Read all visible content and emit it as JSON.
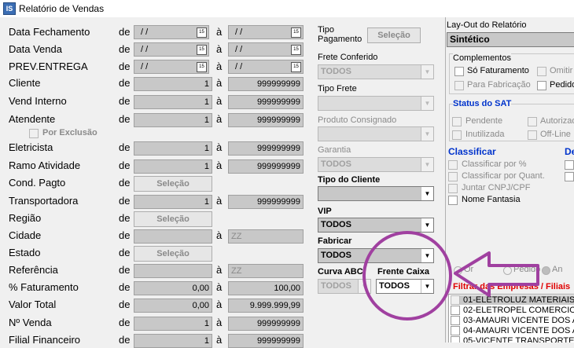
{
  "window": {
    "title": "Relatório de Vendas",
    "icon_text": "IS"
  },
  "common": {
    "de": "de",
    "a": "à",
    "selecao": "Seleção",
    "date_placeholder": "/ /",
    "calendar": "15"
  },
  "fields": {
    "data_fechamento": "Data Fechamento",
    "data_venda": "Data Venda",
    "prev_entrega": "PREV.ENTREGA",
    "cliente": "Cliente",
    "vend_interno": "Vend Interno",
    "atendente": "Atendente",
    "por_exclusao": "Por Exclusão",
    "eletricista": "Eletricista",
    "ramo_atividade": "Ramo Atividade",
    "cond_pagto": "Cond. Pagto",
    "transportadora": "Transportadora",
    "regiao": "Região",
    "cidade": "Cidade",
    "estado": "Estado",
    "referencia": "Referência",
    "pct_faturamento": "% Faturamento",
    "valor_total": "Valor Total",
    "n_venda": "Nº Venda",
    "filial_financeiro": "Filial Financeiro"
  },
  "values": {
    "one": "1",
    "max_id": "999999999",
    "zz": "ZZ",
    "pct_from": "0,00",
    "pct_to": "100,00",
    "valor_from": "0,00",
    "valor_to": "9.999.999,99"
  },
  "middle": {
    "tipo_pagamento": "Tipo Pagamento",
    "tipo_pagamento_btn": "Seleção",
    "frete_conferido": "Frete Conferido",
    "frete_conferido_value": "TODOS",
    "tipo_frete": "Tipo Frete",
    "produto_consignado": "Produto Consignado",
    "garantia": "Garantia",
    "garantia_value": "TODOS",
    "tipo_cliente": "Tipo do Cliente",
    "vip": "VIP",
    "vip_value": "TODOS",
    "fabricar": "Fabricar",
    "fabricar_value": "TODOS",
    "curva_abc": "Curva ABC",
    "curva_abc_value": "TODOS",
    "frente_caixa": "Frente Caixa",
    "frente_caixa_value": "TODOS"
  },
  "right": {
    "layout_label": "Lay-Out do Relatório",
    "layout_value": "Sintético",
    "complementos": "Complementos",
    "so_faturamento": "Só Faturamento",
    "omitir": "Omitir",
    "para_fabricacao": "Para Fabricação",
    "pedido": "Pedido",
    "status_sat": "Status do SAT",
    "pendente": "Pendente",
    "autorizado": "Autorizad",
    "inutilizada": "Inutilizada",
    "offline": "Off-Line",
    "classificar": "Classificar",
    "classificar_de": "De",
    "classificar_pct": "Classificar por %",
    "classificar_quant": "Classificar por Quant.",
    "juntar_cnpj": "Juntar CNPJ/CPF",
    "nome_fantasia": "Nome Fantasia",
    "radio_1": "Or",
    "radio_2": "Pedido",
    "radio_3": "An",
    "filtrar_empresas": "Filtrar das Empresas / Filiais",
    "empresas": [
      "01-ELETROLUZ MATERIAIS",
      "02-ELETROPEL COMERCIO",
      "03-AMAURI VICENTE DOS A",
      "04-AMAURI VICENTE DOS A",
      "05-VICENTE TRANSPORTES"
    ]
  },
  "colors": {
    "annotation": "#a040a0",
    "blue_label": "#0033cc",
    "red_label": "#e00000"
  }
}
